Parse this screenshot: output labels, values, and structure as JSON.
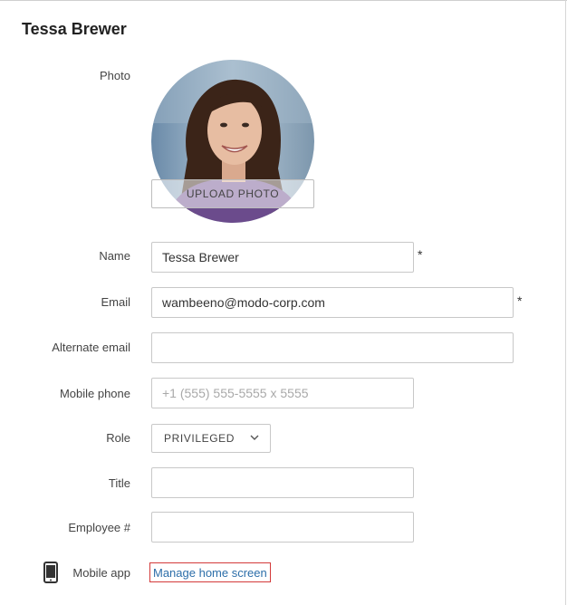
{
  "page": {
    "title": "Tessa Brewer"
  },
  "photo": {
    "label": "Photo",
    "upload_label": "UPLOAD PHOTO"
  },
  "fields": {
    "name": {
      "label": "Name",
      "value": "Tessa Brewer",
      "required_mark": "*"
    },
    "email": {
      "label": "Email",
      "value": "wambeeno@modo-corp.com",
      "required_mark": "*"
    },
    "alternate_email": {
      "label": "Alternate email",
      "value": ""
    },
    "mobile_phone": {
      "label": "Mobile phone",
      "placeholder": "+1 (555) 555-5555 x 5555"
    },
    "role": {
      "label": "Role",
      "value": "PRIVILEGED"
    },
    "title": {
      "label": "Title",
      "value": ""
    },
    "employee_number": {
      "label": "Employee #",
      "value": ""
    }
  },
  "mobile_app": {
    "label": "Mobile app",
    "link": "Manage home screen",
    "icon": "mobile-phone-icon"
  },
  "colors": {
    "link": "#2c6ea9",
    "focus_outline": "#d33a3a"
  }
}
